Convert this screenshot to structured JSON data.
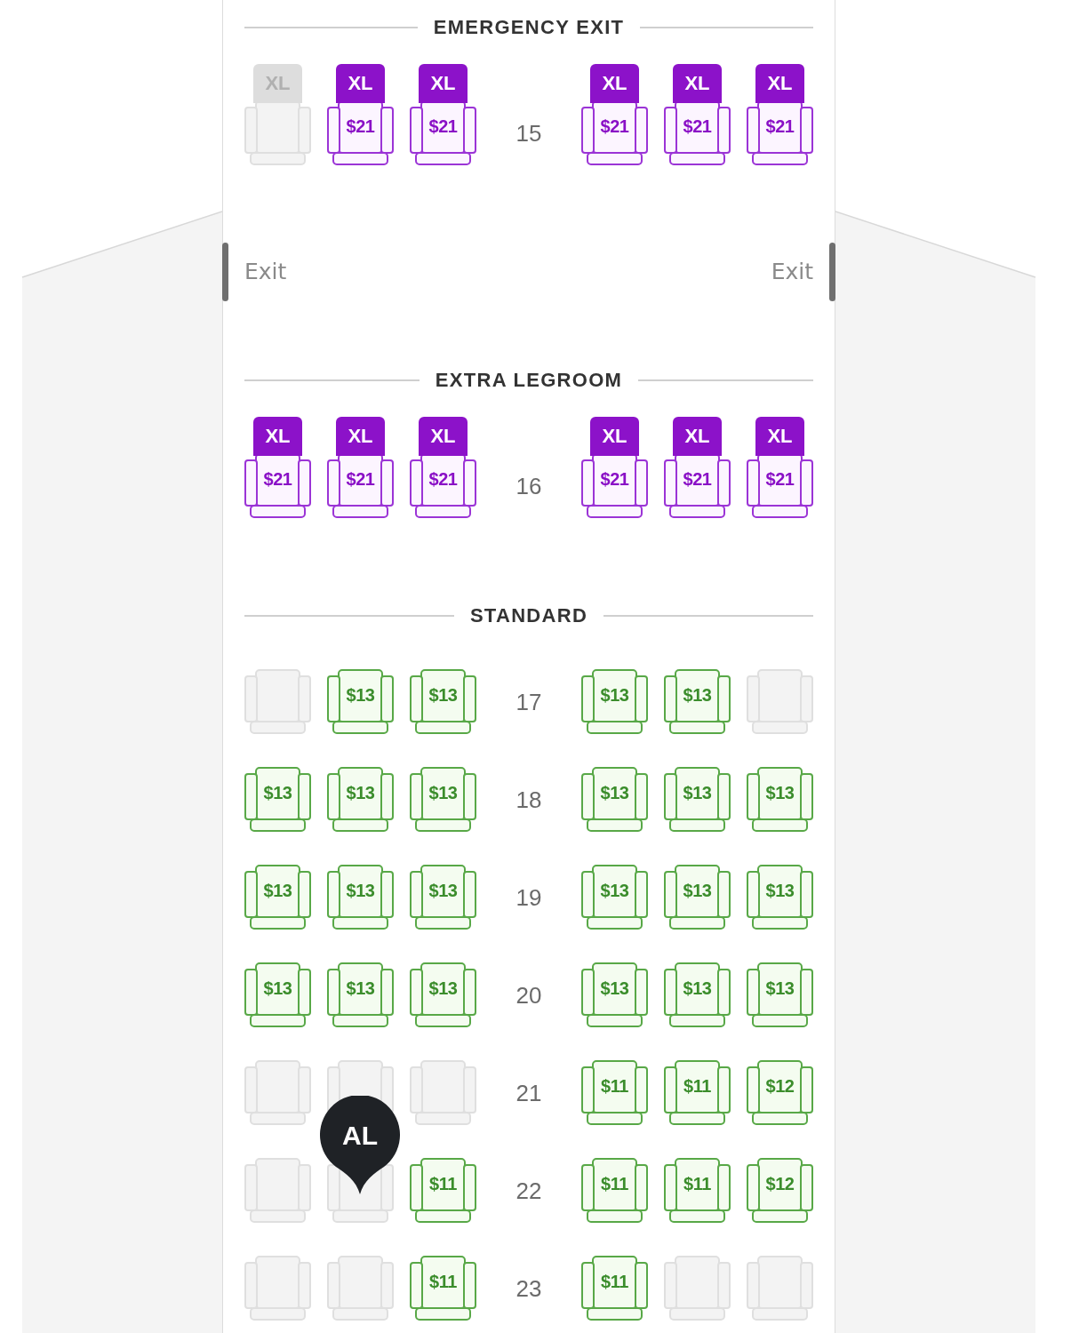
{
  "sections": [
    {
      "title": "EMERGENCY EXIT",
      "rows": [
        {
          "number": "15",
          "seats": [
            {
              "kind": "xl",
              "badge": "XL",
              "available": false
            },
            {
              "kind": "xl",
              "badge": "XL",
              "available": true,
              "price": "$21"
            },
            {
              "kind": "xl",
              "badge": "XL",
              "available": true,
              "price": "$21"
            },
            {
              "kind": "xl",
              "badge": "XL",
              "available": true,
              "price": "$21"
            },
            {
              "kind": "xl",
              "badge": "XL",
              "available": true,
              "price": "$21"
            },
            {
              "kind": "xl",
              "badge": "XL",
              "available": true,
              "price": "$21"
            }
          ]
        }
      ],
      "exits": [
        {
          "label": "Exit"
        },
        {
          "label": "Exit"
        }
      ]
    },
    {
      "title": "EXTRA LEGROOM",
      "rows": [
        {
          "number": "16",
          "seats": [
            {
              "kind": "xl",
              "badge": "XL",
              "available": true,
              "price": "$21"
            },
            {
              "kind": "xl",
              "badge": "XL",
              "available": true,
              "price": "$21"
            },
            {
              "kind": "xl",
              "badge": "XL",
              "available": true,
              "price": "$21"
            },
            {
              "kind": "xl",
              "badge": "XL",
              "available": true,
              "price": "$21"
            },
            {
              "kind": "xl",
              "badge": "XL",
              "available": true,
              "price": "$21"
            },
            {
              "kind": "xl",
              "badge": "XL",
              "available": true,
              "price": "$21"
            }
          ]
        }
      ]
    },
    {
      "title": "STANDARD",
      "rows": [
        {
          "number": "17",
          "seats": [
            {
              "kind": "standard",
              "available": false
            },
            {
              "kind": "standard",
              "available": true,
              "price": "$13"
            },
            {
              "kind": "standard",
              "available": true,
              "price": "$13"
            },
            {
              "kind": "standard",
              "available": true,
              "price": "$13"
            },
            {
              "kind": "standard",
              "available": true,
              "price": "$13"
            },
            {
              "kind": "standard",
              "available": false
            }
          ]
        },
        {
          "number": "18",
          "seats": [
            {
              "kind": "standard",
              "available": true,
              "price": "$13"
            },
            {
              "kind": "standard",
              "available": true,
              "price": "$13"
            },
            {
              "kind": "standard",
              "available": true,
              "price": "$13"
            },
            {
              "kind": "standard",
              "available": true,
              "price": "$13"
            },
            {
              "kind": "standard",
              "available": true,
              "price": "$13"
            },
            {
              "kind": "standard",
              "available": true,
              "price": "$13"
            }
          ]
        },
        {
          "number": "19",
          "seats": [
            {
              "kind": "standard",
              "available": true,
              "price": "$13"
            },
            {
              "kind": "standard",
              "available": true,
              "price": "$13"
            },
            {
              "kind": "standard",
              "available": true,
              "price": "$13"
            },
            {
              "kind": "standard",
              "available": true,
              "price": "$13"
            },
            {
              "kind": "standard",
              "available": true,
              "price": "$13"
            },
            {
              "kind": "standard",
              "available": true,
              "price": "$13"
            }
          ]
        },
        {
          "number": "20",
          "seats": [
            {
              "kind": "standard",
              "available": true,
              "price": "$13"
            },
            {
              "kind": "standard",
              "available": true,
              "price": "$13"
            },
            {
              "kind": "standard",
              "available": true,
              "price": "$13"
            },
            {
              "kind": "standard",
              "available": true,
              "price": "$13"
            },
            {
              "kind": "standard",
              "available": true,
              "price": "$13"
            },
            {
              "kind": "standard",
              "available": true,
              "price": "$13"
            }
          ]
        },
        {
          "number": "21",
          "seats": [
            {
              "kind": "standard",
              "available": false
            },
            {
              "kind": "standard",
              "available": false
            },
            {
              "kind": "standard",
              "available": false
            },
            {
              "kind": "standard",
              "available": true,
              "price": "$11"
            },
            {
              "kind": "standard",
              "available": true,
              "price": "$11"
            },
            {
              "kind": "standard",
              "available": true,
              "price": "$12"
            }
          ]
        },
        {
          "number": "22",
          "seats": [
            {
              "kind": "standard",
              "available": false
            },
            {
              "kind": "standard",
              "available": false,
              "passenger": "AL"
            },
            {
              "kind": "standard",
              "available": true,
              "price": "$11"
            },
            {
              "kind": "standard",
              "available": true,
              "price": "$11"
            },
            {
              "kind": "standard",
              "available": true,
              "price": "$11"
            },
            {
              "kind": "standard",
              "available": true,
              "price": "$12"
            }
          ]
        },
        {
          "number": "23",
          "seats": [
            {
              "kind": "standard",
              "available": false
            },
            {
              "kind": "standard",
              "available": false
            },
            {
              "kind": "standard",
              "available": true,
              "price": "$11"
            },
            {
              "kind": "standard",
              "available": true,
              "price": "$11"
            },
            {
              "kind": "standard",
              "available": false
            },
            {
              "kind": "standard",
              "available": false
            }
          ]
        }
      ]
    }
  ]
}
